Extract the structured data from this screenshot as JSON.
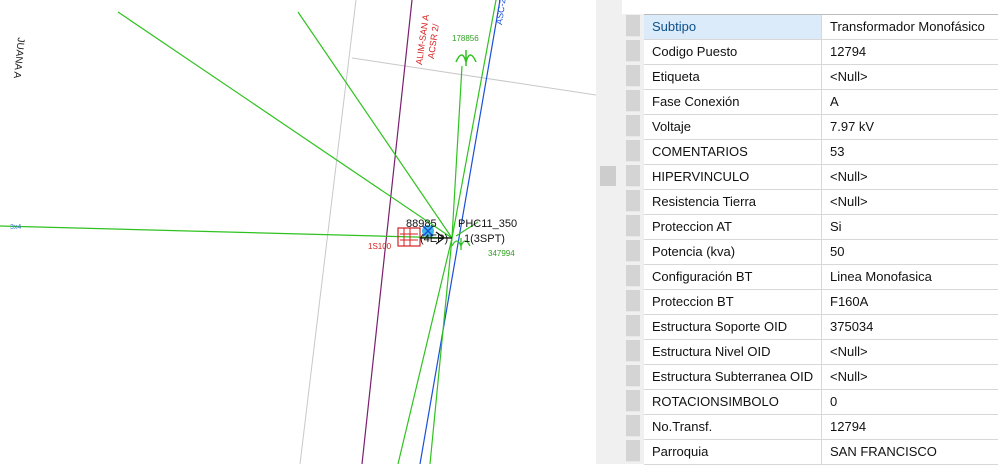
{
  "map": {
    "street_label": "JUANA A",
    "line_label_1": "ALIM-SAN A",
    "line_label_2": "ACSR 2/",
    "line_label_3": "ASC-2",
    "node_label_top": "178856",
    "node_label_1": "88985",
    "node_label_2": "PHC11_350",
    "node_label_3": "(4EP)",
    "node_label_4": "1(3SPT)",
    "node_label_5": "347994",
    "node_label_6": "1S100",
    "left_label": "3x4",
    "colors": {
      "green": "#2fc21f",
      "purple": "#7a1f6e",
      "blue": "#1b4fd8",
      "red": "#d42020",
      "cyan": "#3fb9e8",
      "grid": "#c8c8c8"
    }
  },
  "properties": {
    "selected_index": 0,
    "rows": [
      {
        "key": "Subtipo",
        "value": "Transformador Monofásico"
      },
      {
        "key": "Codigo Puesto",
        "value": "12794"
      },
      {
        "key": "Etiqueta",
        "value": "<Null>"
      },
      {
        "key": "Fase Conexión",
        "value": "A"
      },
      {
        "key": "Voltaje",
        "value": "7.97 kV"
      },
      {
        "key": "COMENTARIOS",
        "value": "53"
      },
      {
        "key": "HIPERVINCULO",
        "value": "<Null>"
      },
      {
        "key": "Resistencia Tierra",
        "value": "<Null>"
      },
      {
        "key": "Proteccion AT",
        "value": "Si"
      },
      {
        "key": "Potencia (kva)",
        "value": "50"
      },
      {
        "key": "Configuración BT",
        "value": "Linea Monofasica"
      },
      {
        "key": "Proteccion BT",
        "value": "F160A"
      },
      {
        "key": "Estructura Soporte OID",
        "value": "375034"
      },
      {
        "key": "Estructura Nivel OID",
        "value": "<Null>"
      },
      {
        "key": "Estructura Subterranea OID",
        "value": "<Null>"
      },
      {
        "key": "ROTACIONSIMBOLO",
        "value": "0"
      },
      {
        "key": "No.Transf.",
        "value": "12794"
      },
      {
        "key": "Parroquia",
        "value": "SAN FRANCISCO"
      }
    ]
  }
}
